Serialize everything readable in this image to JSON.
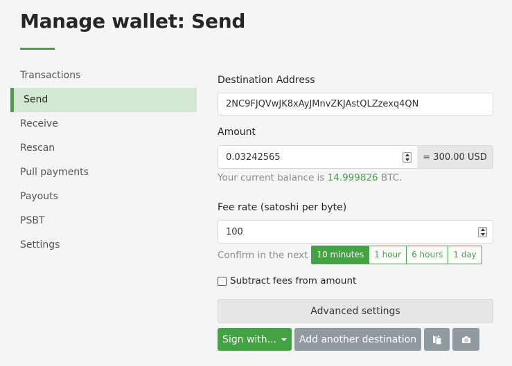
{
  "header": {
    "title": "Manage wallet: Send"
  },
  "sidebar": {
    "items": [
      {
        "label": "Transactions"
      },
      {
        "label": "Send",
        "active": true
      },
      {
        "label": "Receive"
      },
      {
        "label": "Rescan"
      },
      {
        "label": "Pull payments"
      },
      {
        "label": "Payouts"
      },
      {
        "label": "PSBT"
      },
      {
        "label": "Settings"
      }
    ]
  },
  "form": {
    "destination": {
      "label": "Destination Address",
      "value": "2NC9FJQVwJK8xAyJMnvZKJAstQLZzexq4QN"
    },
    "amount": {
      "label": "Amount",
      "value": "0.03242565",
      "fiat": "= 300.00 USD"
    },
    "balance": {
      "prefix": "Your current balance is",
      "amount": "14.999826",
      "suffix": "BTC."
    },
    "fee": {
      "label": "Fee rate (satoshi per byte)",
      "value": "100",
      "confirm_label": "Confirm in the next",
      "options": [
        "10 minutes",
        "1 hour",
        "6 hours",
        "1 day"
      ],
      "selected": "10 minutes"
    },
    "subtract_fees": {
      "label": "Subtract fees from amount",
      "checked": false
    },
    "advanced_label": "Advanced settings",
    "buttons": {
      "sign_label": "Sign with...",
      "add_destination_label": "Add another destination",
      "paste_icon": "clipboard-icon",
      "scan_icon": "camera-icon"
    }
  },
  "colors": {
    "accent": "#44a244",
    "grey_button": "#919aa1",
    "active_nav_bg": "#d2e8d2"
  }
}
